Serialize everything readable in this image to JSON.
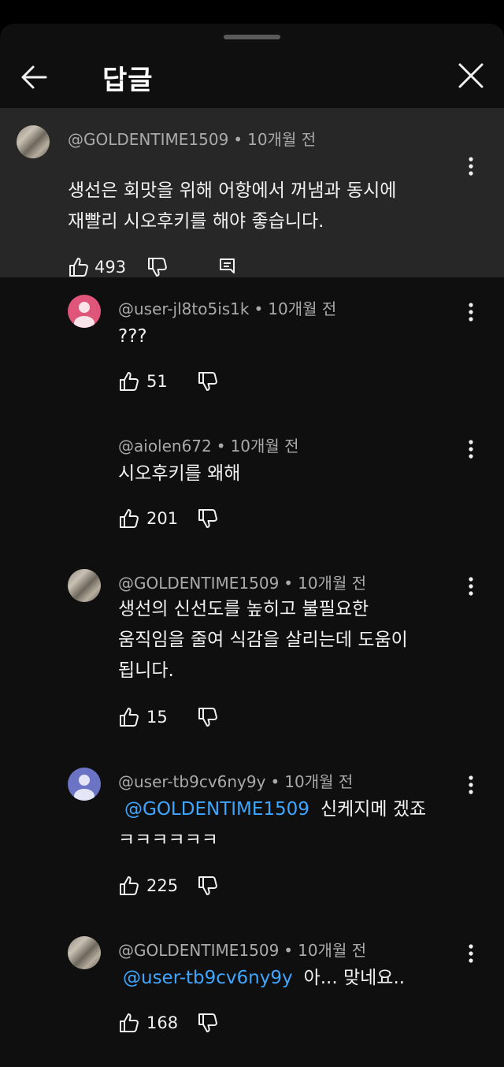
{
  "header": {
    "title": "답글"
  },
  "parent_comment": {
    "author": "@GOLDENTIME1509",
    "time": "10개월 전",
    "lines": [
      "생선은 회맛을 위해 어항에서 꺼냄과 동시에",
      "재빨리 시오후키를 해야 좋습니다."
    ],
    "likes": "493"
  },
  "replies": [
    {
      "author": "@user-jl8to5is1k",
      "time": "10개월 전",
      "lines": [
        "???"
      ],
      "likes": "51"
    },
    {
      "author": "@aiolen672",
      "time": "10개월 전",
      "lines": [
        "시오후키를 왜해"
      ],
      "likes": "201"
    },
    {
      "author": "@GOLDENTIME1509",
      "time": "10개월 전",
      "lines": [
        "생선의 신선도를 높히고 불필요한",
        "움직임을 줄여 식감을 살리는데 도움이",
        "됩니다."
      ],
      "likes": "15"
    },
    {
      "author": "@user-tb9cv6ny9y",
      "time": "10개월 전",
      "mention": "@GOLDENTIME1509",
      "lines": [
        "신케지메 겠죠",
        "ㅋㅋㅋㅋㅋㅋ"
      ],
      "likes": "225"
    },
    {
      "author": "@GOLDENTIME1509",
      "time": "10개월 전",
      "mention": "@user-tb9cv6ny9y",
      "lines": [
        "아... 맞네요.."
      ],
      "likes": "168"
    }
  ],
  "colors": {
    "background": "#0f0f0f",
    "highlight": "#272727",
    "mention": "#3ea6ff",
    "meta": "#aaaaaa",
    "pink_avatar": "#e0557a",
    "blue_avatar": "#6b73c4"
  },
  "icons": [
    "arrow-left-icon",
    "close-icon",
    "thumbs-up-icon",
    "thumbs-down-icon",
    "reply-icon",
    "more-vert-icon",
    "person-icon"
  ]
}
